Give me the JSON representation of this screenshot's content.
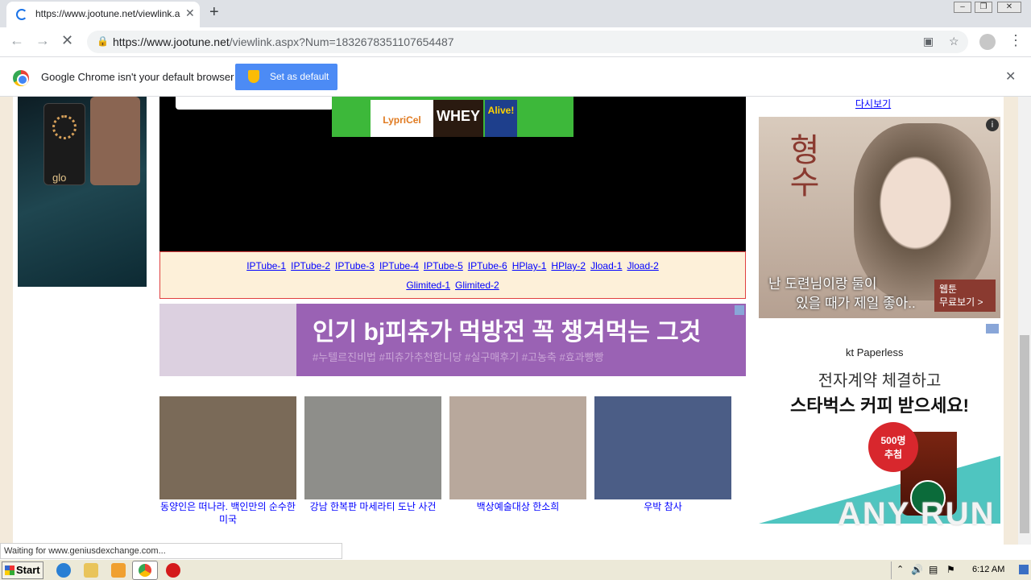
{
  "browser": {
    "tab_title": "https://www.jootune.net/viewlink.a",
    "url_host": "https://www.jootune.net",
    "url_path": "/viewlink.aspx?Num=1832678351107654487"
  },
  "infobar": {
    "message": "Google Chrome isn't your default browser",
    "button_label": "Set as default"
  },
  "left_ad": {
    "label": "glo"
  },
  "video_ad": {
    "products": [
      "LypriCel",
      "WHEY",
      "Alive!"
    ]
  },
  "links": {
    "row1": [
      "IPTube-1",
      "IPTube-2",
      "IPTube-3",
      "IPTube-4",
      "IPTube-5",
      "IPTube-6",
      "HPlay-1",
      "HPlay-2",
      "Jload-1",
      "Jload-2"
    ],
    "row2": [
      "Glimited-1",
      "Glimited-2"
    ]
  },
  "banner": {
    "title": "인기 bj피츄가 먹방전 꼭 챙겨먹는 그것",
    "subtitle": "#누텔르진비법 #피츄가추천합니당 #실구매후기 #고농축 #효과빵빵"
  },
  "thumbs": [
    {
      "caption": "동양인은 떠나라. 백인만의 순수한 미국",
      "color": "#7a6a58"
    },
    {
      "caption": "강남 한복판 마세라티 도난 사건",
      "color": "#8e8e8a"
    },
    {
      "caption": "백상예술대상 한소희",
      "color": "#b8a89c"
    },
    {
      "caption": "우박 참사",
      "color": "#4b5d86"
    }
  ],
  "right": {
    "link": "다시보기",
    "webtoon": {
      "title": "형수",
      "caption_line1": "난 도련님이랑 둘이",
      "caption_line2": "있을 때가 제일 좋아..",
      "button_line1": "웹툰",
      "button_line2": "무료보기 >",
      "info": "i"
    },
    "kt": {
      "logo": "kt Paperless",
      "line1": "전자계약 체결하고",
      "line2": "스타벅스 커피 받으세요!",
      "badge_line1": "500명",
      "badge_line2": "추첨"
    },
    "watermark": "ANY RUN"
  },
  "status": "Waiting for www.geniusdexchange.com...",
  "taskbar": {
    "start": "Start",
    "clock": "6:12 AM"
  }
}
